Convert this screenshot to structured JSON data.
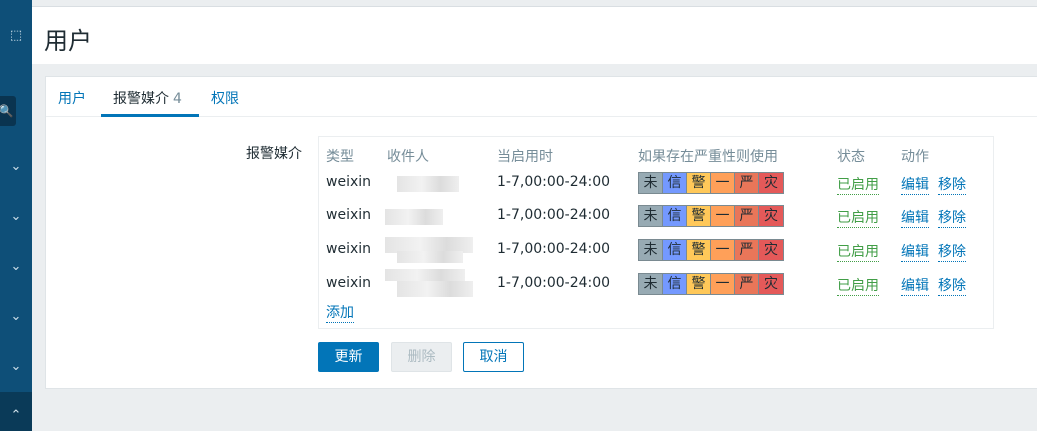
{
  "sidebar": {
    "icons": [
      {
        "name": "bracket-square-icon",
        "glyph": "⬚"
      },
      {
        "name": "search-icon",
        "glyph": "🔍"
      },
      {
        "name": "chevron-down-icon",
        "glyph": "⌄"
      },
      {
        "name": "chevron-down-icon",
        "glyph": "⌄"
      },
      {
        "name": "chevron-down-icon",
        "glyph": "⌄"
      },
      {
        "name": "chevron-down-icon",
        "glyph": "⌄"
      },
      {
        "name": "chevron-down-icon",
        "glyph": "⌄"
      },
      {
        "name": "chevron-up-icon",
        "glyph": "⌃"
      }
    ]
  },
  "header": {
    "title": "用户"
  },
  "tabs": [
    {
      "label": "用户",
      "count": ""
    },
    {
      "label": "报警媒介",
      "count": "4"
    },
    {
      "label": "权限",
      "count": ""
    }
  ],
  "media": {
    "label": "报警媒介",
    "columns": [
      "类型",
      "收件人",
      "当启用时",
      "如果存在严重性则使用",
      "状态",
      "动作"
    ],
    "severity_labels": [
      "未",
      "信",
      "警",
      "一",
      "严",
      "灾"
    ],
    "severity_colors": [
      "#97aab3",
      "#7499ff",
      "#ffc859",
      "#ffa059",
      "#e97659",
      "#e45959"
    ],
    "rows": [
      {
        "type": "weixin",
        "when": "1-7,00:00-24:00",
        "status": "已启用",
        "edit": "编辑",
        "remove": "移除"
      },
      {
        "type": "weixin",
        "when": "1-7,00:00-24:00",
        "status": "已启用",
        "edit": "编辑",
        "remove": "移除"
      },
      {
        "type": "weixin",
        "when": "1-7,00:00-24:00",
        "status": "已启用",
        "edit": "编辑",
        "remove": "移除"
      },
      {
        "type": "weixin",
        "when": "1-7,00:00-24:00",
        "status": "已启用",
        "edit": "编辑",
        "remove": "移除"
      }
    ],
    "add_label": "添加"
  },
  "buttons": {
    "update": "更新",
    "delete": "删除",
    "cancel": "取消"
  }
}
